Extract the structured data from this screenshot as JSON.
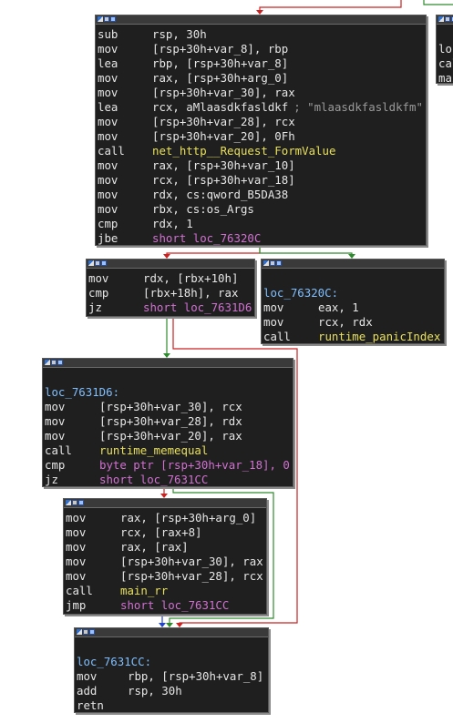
{
  "colors": {
    "canvas": "#ffffff",
    "node_bg": "#1f1f1f",
    "edge_true": "#2e8b2e",
    "edge_false": "#cc2222",
    "edge_uncond": "#2244cc",
    "mnemonic": "#e6e6e6",
    "keyword": "#d070d0",
    "name": "#e8e05a",
    "label": "#7fbfff",
    "comment": "#9a9a9a"
  },
  "nodes": [
    {
      "id": "block-main-entry",
      "lines": [
        {
          "m": "sub",
          "o": "rsp, 30h"
        },
        {
          "m": "mov",
          "o": "[rsp+30h+var_8], rbp"
        },
        {
          "m": "lea",
          "o": "rbp, [rsp+30h+var_8]"
        },
        {
          "m": "mov",
          "o": "rax, [rsp+30h+arg_0]"
        },
        {
          "m": "mov",
          "o": "[rsp+30h+var_30], rax"
        },
        {
          "m": "lea",
          "o": "rcx, aMlaasdkfasldkf",
          "c": "; \"mlaasdkfasldkfm\""
        },
        {
          "m": "mov",
          "o": "[rsp+30h+var_28], rcx"
        },
        {
          "m": "mov",
          "o": "[rsp+30h+var_20], 0Fh"
        },
        {
          "m": "call",
          "o": "net_http__Request_FormValue"
        },
        {
          "m": "mov",
          "o": "rax, [rsp+30h+var_10]"
        },
        {
          "m": "mov",
          "o": "rcx, [rsp+30h+var_18]"
        },
        {
          "m": "mov",
          "o": "rdx, cs:qword_B5DA38"
        },
        {
          "m": "mov",
          "o": "rbx, cs:os_Args"
        },
        {
          "m": "cmp",
          "o": "rdx, 1"
        },
        {
          "m": "jbe",
          "o": "short loc_76320C"
        }
      ]
    },
    {
      "id": "block-right-partial",
      "lines": [
        {
          "m": "",
          "o": ""
        },
        {
          "m": "loc",
          "o": ""
        },
        {
          "m": "cal",
          "o": ""
        },
        {
          "m": "mai",
          "o": ""
        }
      ]
    },
    {
      "id": "block-check-len",
      "lines": [
        {
          "m": "mov",
          "o": "rdx, [rbx+10h]"
        },
        {
          "m": "cmp",
          "o": "[rbx+18h], rax"
        },
        {
          "m": "jz",
          "o": "short loc_7631D6"
        }
      ]
    },
    {
      "id": "block-panic-index",
      "lines": [
        {
          "m": "",
          "o": ""
        },
        {
          "label": "loc_76320C:"
        },
        {
          "m": "mov",
          "o": "eax, 1"
        },
        {
          "m": "mov",
          "o": "rcx, rdx"
        },
        {
          "m": "call",
          "o": "runtime_panicIndex"
        }
      ]
    },
    {
      "id": "block-memequal",
      "lines": [
        {
          "m": "",
          "o": ""
        },
        {
          "label": "loc_7631D6:"
        },
        {
          "m": "mov",
          "o": "[rsp+30h+var_30], rcx"
        },
        {
          "m": "mov",
          "o": "[rsp+30h+var_28], rdx"
        },
        {
          "m": "mov",
          "o": "[rsp+30h+var_20], rax"
        },
        {
          "m": "call",
          "o": "runtime_memequal"
        },
        {
          "m": "cmp",
          "o": "byte ptr [rsp+30h+var_18], 0"
        },
        {
          "m": "jz",
          "o": "short loc_7631CC"
        }
      ]
    },
    {
      "id": "block-call-main-rr",
      "lines": [
        {
          "m": "mov",
          "o": "rax, [rsp+30h+arg_0]"
        },
        {
          "m": "mov",
          "o": "rcx, [rax+8]"
        },
        {
          "m": "mov",
          "o": "rax, [rax]"
        },
        {
          "m": "mov",
          "o": "[rsp+30h+var_30], rax"
        },
        {
          "m": "mov",
          "o": "[rsp+30h+var_28], rcx"
        },
        {
          "m": "call",
          "o": "main_rr"
        },
        {
          "m": "jmp",
          "o": "short loc_7631CC"
        }
      ]
    },
    {
      "id": "block-epilogue",
      "lines": [
        {
          "m": "",
          "o": ""
        },
        {
          "label": "loc_7631CC:"
        },
        {
          "m": "mov",
          "o": "rbp, [rsp+30h+var_8]"
        },
        {
          "m": "add",
          "o": "rsp, 30h"
        },
        {
          "m": "retn",
          "o": ""
        }
      ]
    }
  ]
}
